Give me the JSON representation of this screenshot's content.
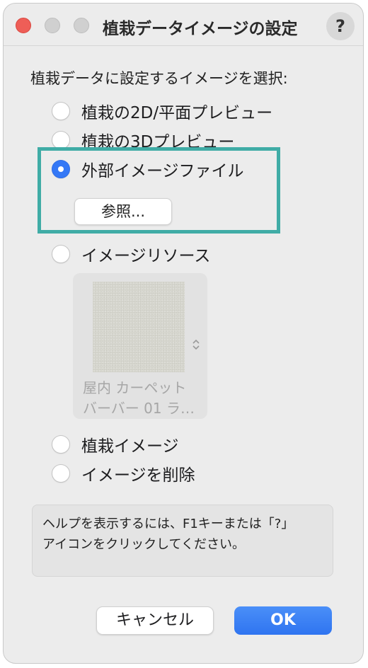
{
  "window": {
    "title": "植栽データイメージの設定",
    "help_button": "?"
  },
  "prompt": "植栽データに設定するイメージを選択:",
  "options": [
    {
      "label": "植栽の2D/平面プレビュー",
      "selected": false
    },
    {
      "label": "植栽の3Dプレビュー",
      "selected": false
    },
    {
      "label": "外部イメージファイル",
      "selected": true
    },
    {
      "label": "イメージリソース",
      "selected": false
    },
    {
      "label": "植栽イメージ",
      "selected": false
    },
    {
      "label": "イメージを削除",
      "selected": false
    }
  ],
  "browse_button": "参照...",
  "resource": {
    "name_line1": "屋内 カーペット",
    "name_line2": "バーバー 01 ラ…",
    "stepper_icon": "⌃⌄"
  },
  "help_text": {
    "line1": "ヘルプを表示するには、F1キーまたは「?」",
    "line2": "アイコンをクリックしてください。"
  },
  "buttons": {
    "cancel": "キャンセル",
    "ok": "OK"
  },
  "colors": {
    "accent": "#3478f6",
    "highlight": "#40aca6",
    "close": "#ee5e57"
  }
}
